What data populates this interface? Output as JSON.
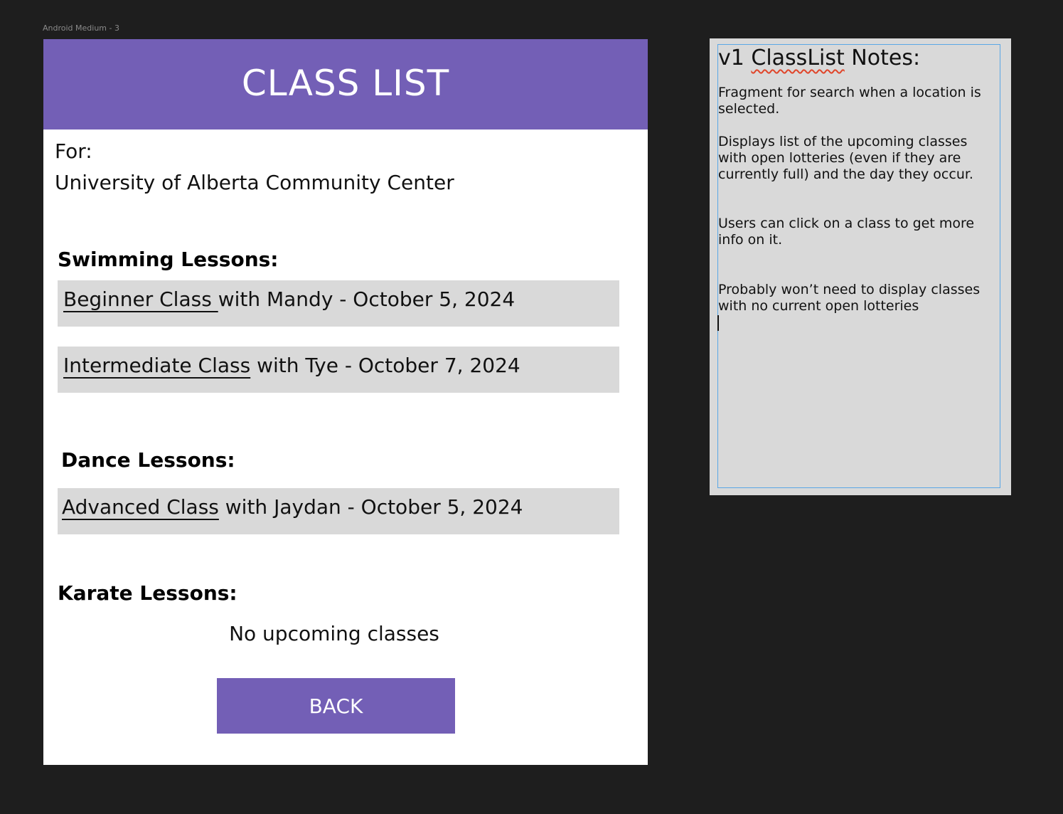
{
  "canvas": {
    "frame_label": "Android Medium - 3"
  },
  "app": {
    "header_title": "CLASS LIST",
    "for_label": "For:",
    "location_name": "University of Alberta Community Center",
    "sections": [
      {
        "heading": "Swimming Lessons:",
        "classes": [
          {
            "name": "Beginner Class ",
            "detail": "with Mandy - October 5, 2024"
          },
          {
            "name": "Intermediate Class",
            "detail": " with Tye - October 7, 2024"
          }
        ]
      },
      {
        "heading": "Dance Lessons:",
        "classes": [
          {
            "name": "Advanced Class",
            "detail": " with Jaydan - October 5, 2024"
          }
        ]
      },
      {
        "heading": "Karate Lessons:",
        "classes": [],
        "empty_text": "No upcoming classes"
      }
    ],
    "back_label": "BACK"
  },
  "notes": {
    "title_prefix": "v1 ",
    "title_underlined": "ClassList",
    "title_suffix": " Notes:",
    "paragraphs": [
      "Fragment for search when a location is selected.",
      "Displays list of the upcoming classes with open lotteries (even if they are currently full) and the day they occur.",
      "Users can click on a class to get more info on it.",
      "Probably won’t need to display classes with no current open lotteries"
    ]
  },
  "colors": {
    "canvas_bg": "#1e1e1e",
    "accent_purple": "#735fb6",
    "card_gray": "#d9d9d9",
    "selection_blue": "#5aa7e6",
    "spellcheck_red": "#e0452a"
  }
}
